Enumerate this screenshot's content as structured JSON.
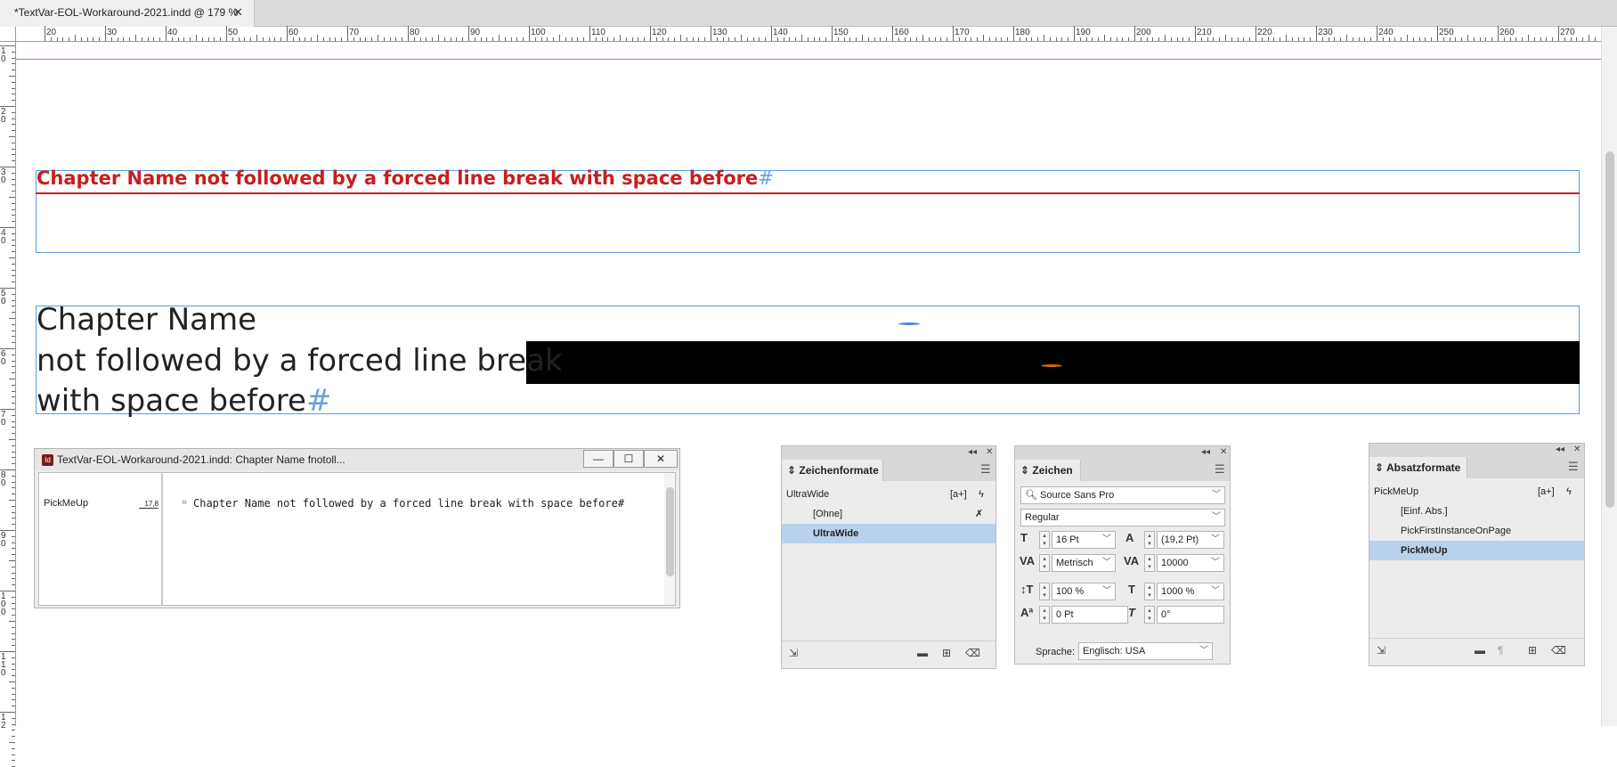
{
  "tab": {
    "title": "*TextVar-EOL-Workaround-2021.indd @ 179 %",
    "close": "✕"
  },
  "ruler_top": {
    "labels": [
      "20",
      "30",
      "40",
      "50",
      "60",
      "70",
      "80",
      "90",
      "100",
      "110",
      "120",
      "130",
      "140",
      "150",
      "160",
      "170",
      "180",
      "190",
      "200",
      "210",
      "220",
      "230",
      "240",
      "250",
      "260",
      "270"
    ]
  },
  "ruler_left": {
    "labels": [
      "1 0",
      "2 0",
      "3 0",
      "4 0",
      "5 0",
      "6 0",
      "7 0",
      "8 0",
      "9 0",
      "1 0 0",
      "1 1 0",
      "1 2"
    ]
  },
  "canvas": {
    "heading1": "Chapter Name not followed by a forced line break with space before",
    "line1": "Chapter Name",
    "line2": "not followed by a forced line break",
    "line3": "with space before",
    "end_marker": "#"
  },
  "story_editor": {
    "title": "TextVar-EOL-Workaround-2021.indd: Chapter Name fnotoll...",
    "style": "PickMeUp",
    "depth": "17,8",
    "arrow": "»",
    "text": "Chapter Name not followed by a forced line break with space before#",
    "min": "—",
    "max": "☐",
    "close": "✕"
  },
  "char_styles": {
    "title": "Zeichenformate",
    "current": "UltraWide",
    "new_label": "[a+]",
    "items": [
      {
        "label": "[Ohne]"
      },
      {
        "label": "UltraWide"
      }
    ]
  },
  "character": {
    "title": "Zeichen",
    "font": "Source Sans Pro",
    "style": "Regular",
    "size": "16 Pt",
    "leading": "(19,2 Pt)",
    "kerning": "Metrisch",
    "tracking": "10000",
    "vscale": "100 %",
    "hscale": "1000 %",
    "baseline": "0 Pt",
    "skew": "0°",
    "language_label": "Sprache:",
    "language": "Englisch: USA"
  },
  "para_styles": {
    "title": "Absatzformate",
    "current": "PickMeUp",
    "new_label": "[a+]",
    "items": [
      {
        "label": "[Einf. Abs.]"
      },
      {
        "label": "PickFirstInstanceOnPage"
      },
      {
        "label": "PickMeUp"
      }
    ]
  }
}
